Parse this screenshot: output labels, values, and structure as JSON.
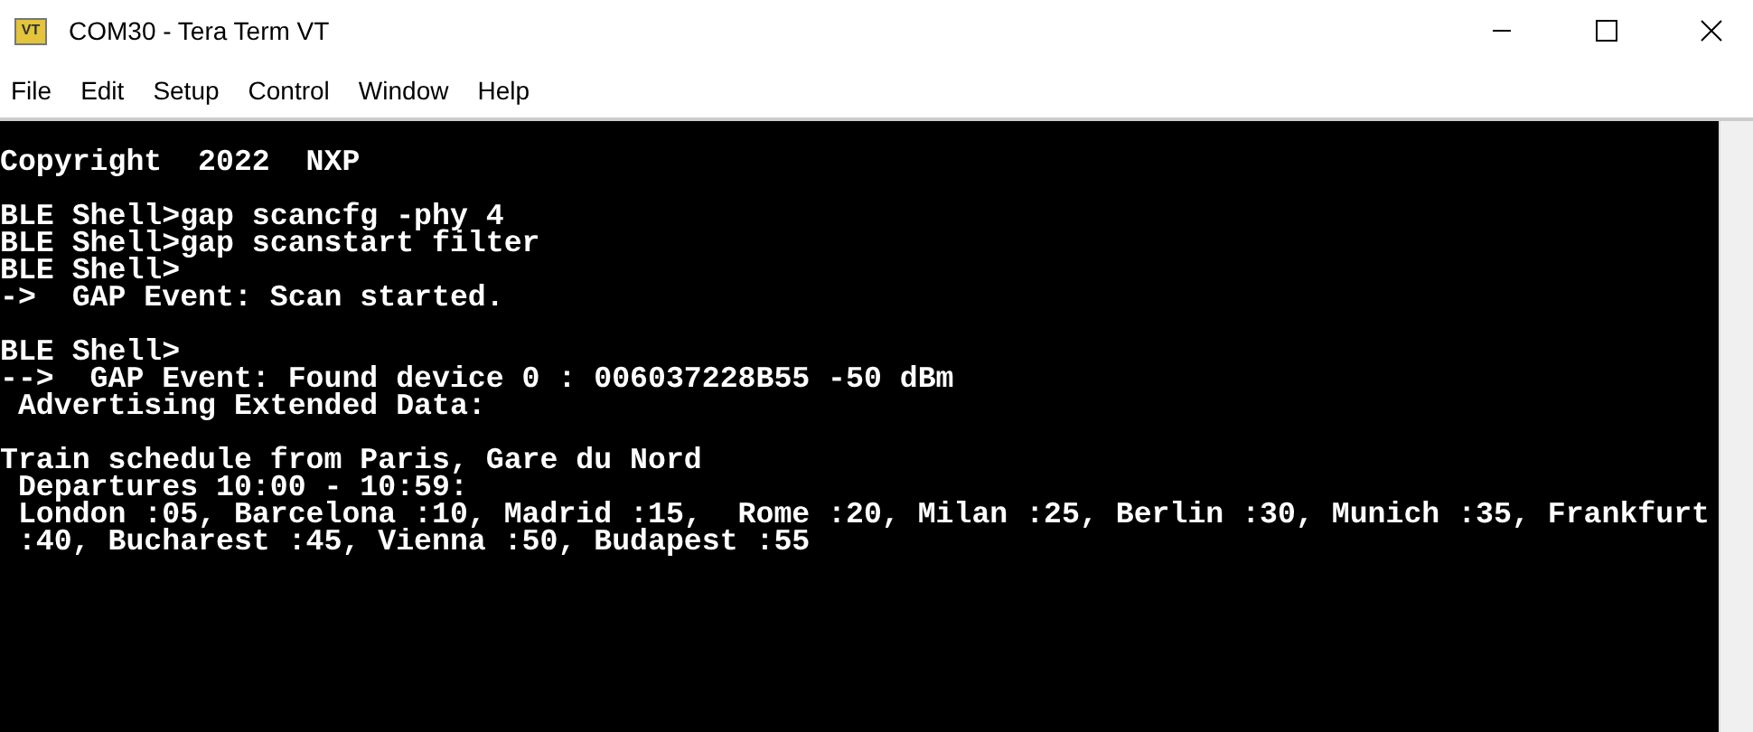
{
  "window": {
    "title": "COM30 - Tera Term VT",
    "app_icon": "VT"
  },
  "menu": [
    "File",
    "Edit",
    "Setup",
    "Control",
    "Window",
    "Help"
  ],
  "terminal": {
    "blocks": [
      [
        "Copyright  2022  NXP"
      ],
      [
        "BLE Shell>gap scancfg -phy 4",
        "BLE Shell>gap scanstart filter",
        "BLE Shell>",
        "->  GAP Event: Scan started."
      ],
      [
        "BLE Shell>",
        "-->  GAP Event: Found device 0 : 006037228B55 -50 dBm",
        " Advertising Extended Data:"
      ],
      [
        "Train schedule from Paris, Gare du Nord",
        " Departures 10:00 - 10:59:",
        " London :05, Barcelona :10, Madrid :15,  Rome :20, Milan :25, Berlin :30, Munich :35, Frankfurt",
        " :40, Bucharest :45, Vienna :50, Budapest :55"
      ]
    ]
  }
}
